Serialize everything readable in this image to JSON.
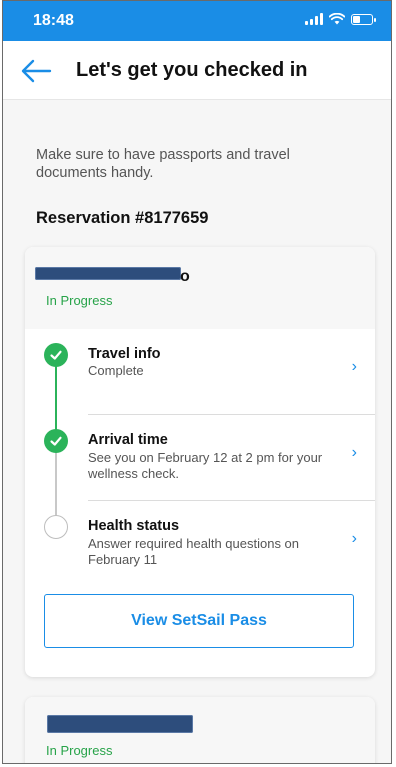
{
  "status_bar": {
    "time": "18:48"
  },
  "header": {
    "title": "Let's get you checked in"
  },
  "intro": "Make sure to have passports and travel documents handy.",
  "reservation": "Reservation #8177659",
  "card1": {
    "name_visible_fragment": "o",
    "status": "In Progress",
    "steps": [
      {
        "title": "Travel info",
        "desc": "Complete",
        "state": "complete"
      },
      {
        "title": "Arrival time",
        "desc": "See you on February 12 at 2 pm for your wellness check.",
        "state": "complete"
      },
      {
        "title": "Health status",
        "desc": "Answer required health questions on February 11",
        "state": "pending"
      }
    ],
    "button": "View SetSail Pass"
  },
  "card2": {
    "status": "In Progress"
  },
  "colors": {
    "accent": "#1a8de6",
    "success": "#2bb35a",
    "status_text": "#27a349"
  },
  "icons": [
    "back-arrow-icon",
    "check-icon",
    "chevron-right-icon",
    "signal-icon",
    "wifi-icon",
    "battery-icon"
  ]
}
